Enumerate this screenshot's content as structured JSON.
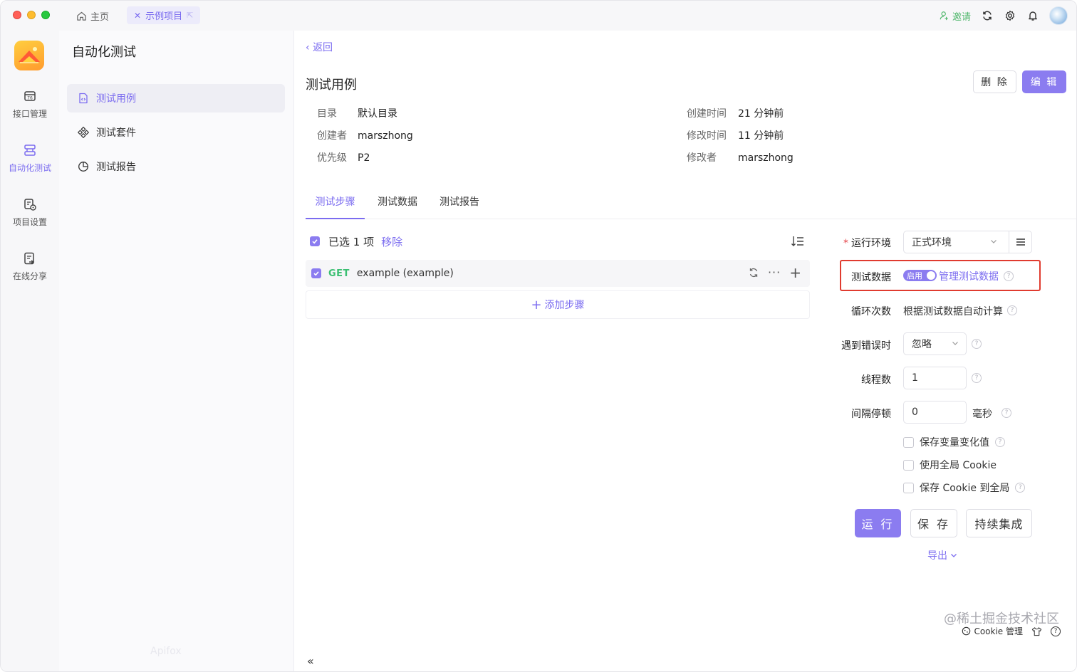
{
  "titlebar": {
    "home_tab": "主页",
    "project_tab": "示例项目",
    "invite": "邀请"
  },
  "rail": {
    "items": [
      {
        "label": "接口管理",
        "icon": "api-icon"
      },
      {
        "label": "自动化测试",
        "icon": "automation-icon",
        "active": true
      },
      {
        "label": "项目设置",
        "icon": "project-settings-icon"
      },
      {
        "label": "在线分享",
        "icon": "share-icon"
      }
    ]
  },
  "sidebar": {
    "title": "自动化测试",
    "items": [
      {
        "label": "测试用例",
        "icon": "file-code-icon",
        "active": true
      },
      {
        "label": "测试套件",
        "icon": "suite-icon"
      },
      {
        "label": "测试报告",
        "icon": "pie-chart-icon"
      }
    ],
    "faint_text": "Apifox"
  },
  "main": {
    "back": "返回",
    "title": "测试用例",
    "delete_btn": "删 除",
    "edit_btn": "编 辑",
    "meta_left": [
      {
        "k": "目录",
        "v": "默认目录"
      },
      {
        "k": "创建者",
        "v": "marszhong"
      },
      {
        "k": "优先级",
        "v": "P2"
      }
    ],
    "meta_right": [
      {
        "k": "创建时间",
        "v": "21 分钟前"
      },
      {
        "k": "修改时间",
        "v": "11 分钟前"
      },
      {
        "k": "修改者",
        "v": "marszhong"
      }
    ],
    "tabs": [
      "测试步骤",
      "测试数据",
      "测试报告"
    ],
    "selection": {
      "text": "已选 1 项",
      "remove": "移除"
    },
    "step": {
      "method": "GET",
      "name": "example (example)"
    },
    "add_step": "添加步骤"
  },
  "config": {
    "env_label": "运行环境",
    "env_value": "正式环境",
    "test_data_label": "测试数据",
    "toggle_text": "启用",
    "manage_data": "管理测试数据",
    "loop_label": "循环次数",
    "loop_value": "根据测试数据自动计算",
    "on_error_label": "遇到错误时",
    "on_error_value": "忽略",
    "threads_label": "线程数",
    "threads_value": "1",
    "interval_label": "间隔停顿",
    "interval_value": "0",
    "interval_unit": "毫秒",
    "checks": [
      "保存变量变化值",
      "使用全局 Cookie",
      "保存 Cookie 到全局"
    ],
    "run_btn": "运 行",
    "save_btn": "保 存",
    "ci_btn": "持续集成",
    "export": "导出"
  },
  "footer": {
    "cookie": "Cookie 管理",
    "watermark": "@稀土掘金技术社区"
  },
  "colors": {
    "accent": "#8b7cf0",
    "get": "#3bbf72",
    "highlight": "#e03b2f"
  }
}
